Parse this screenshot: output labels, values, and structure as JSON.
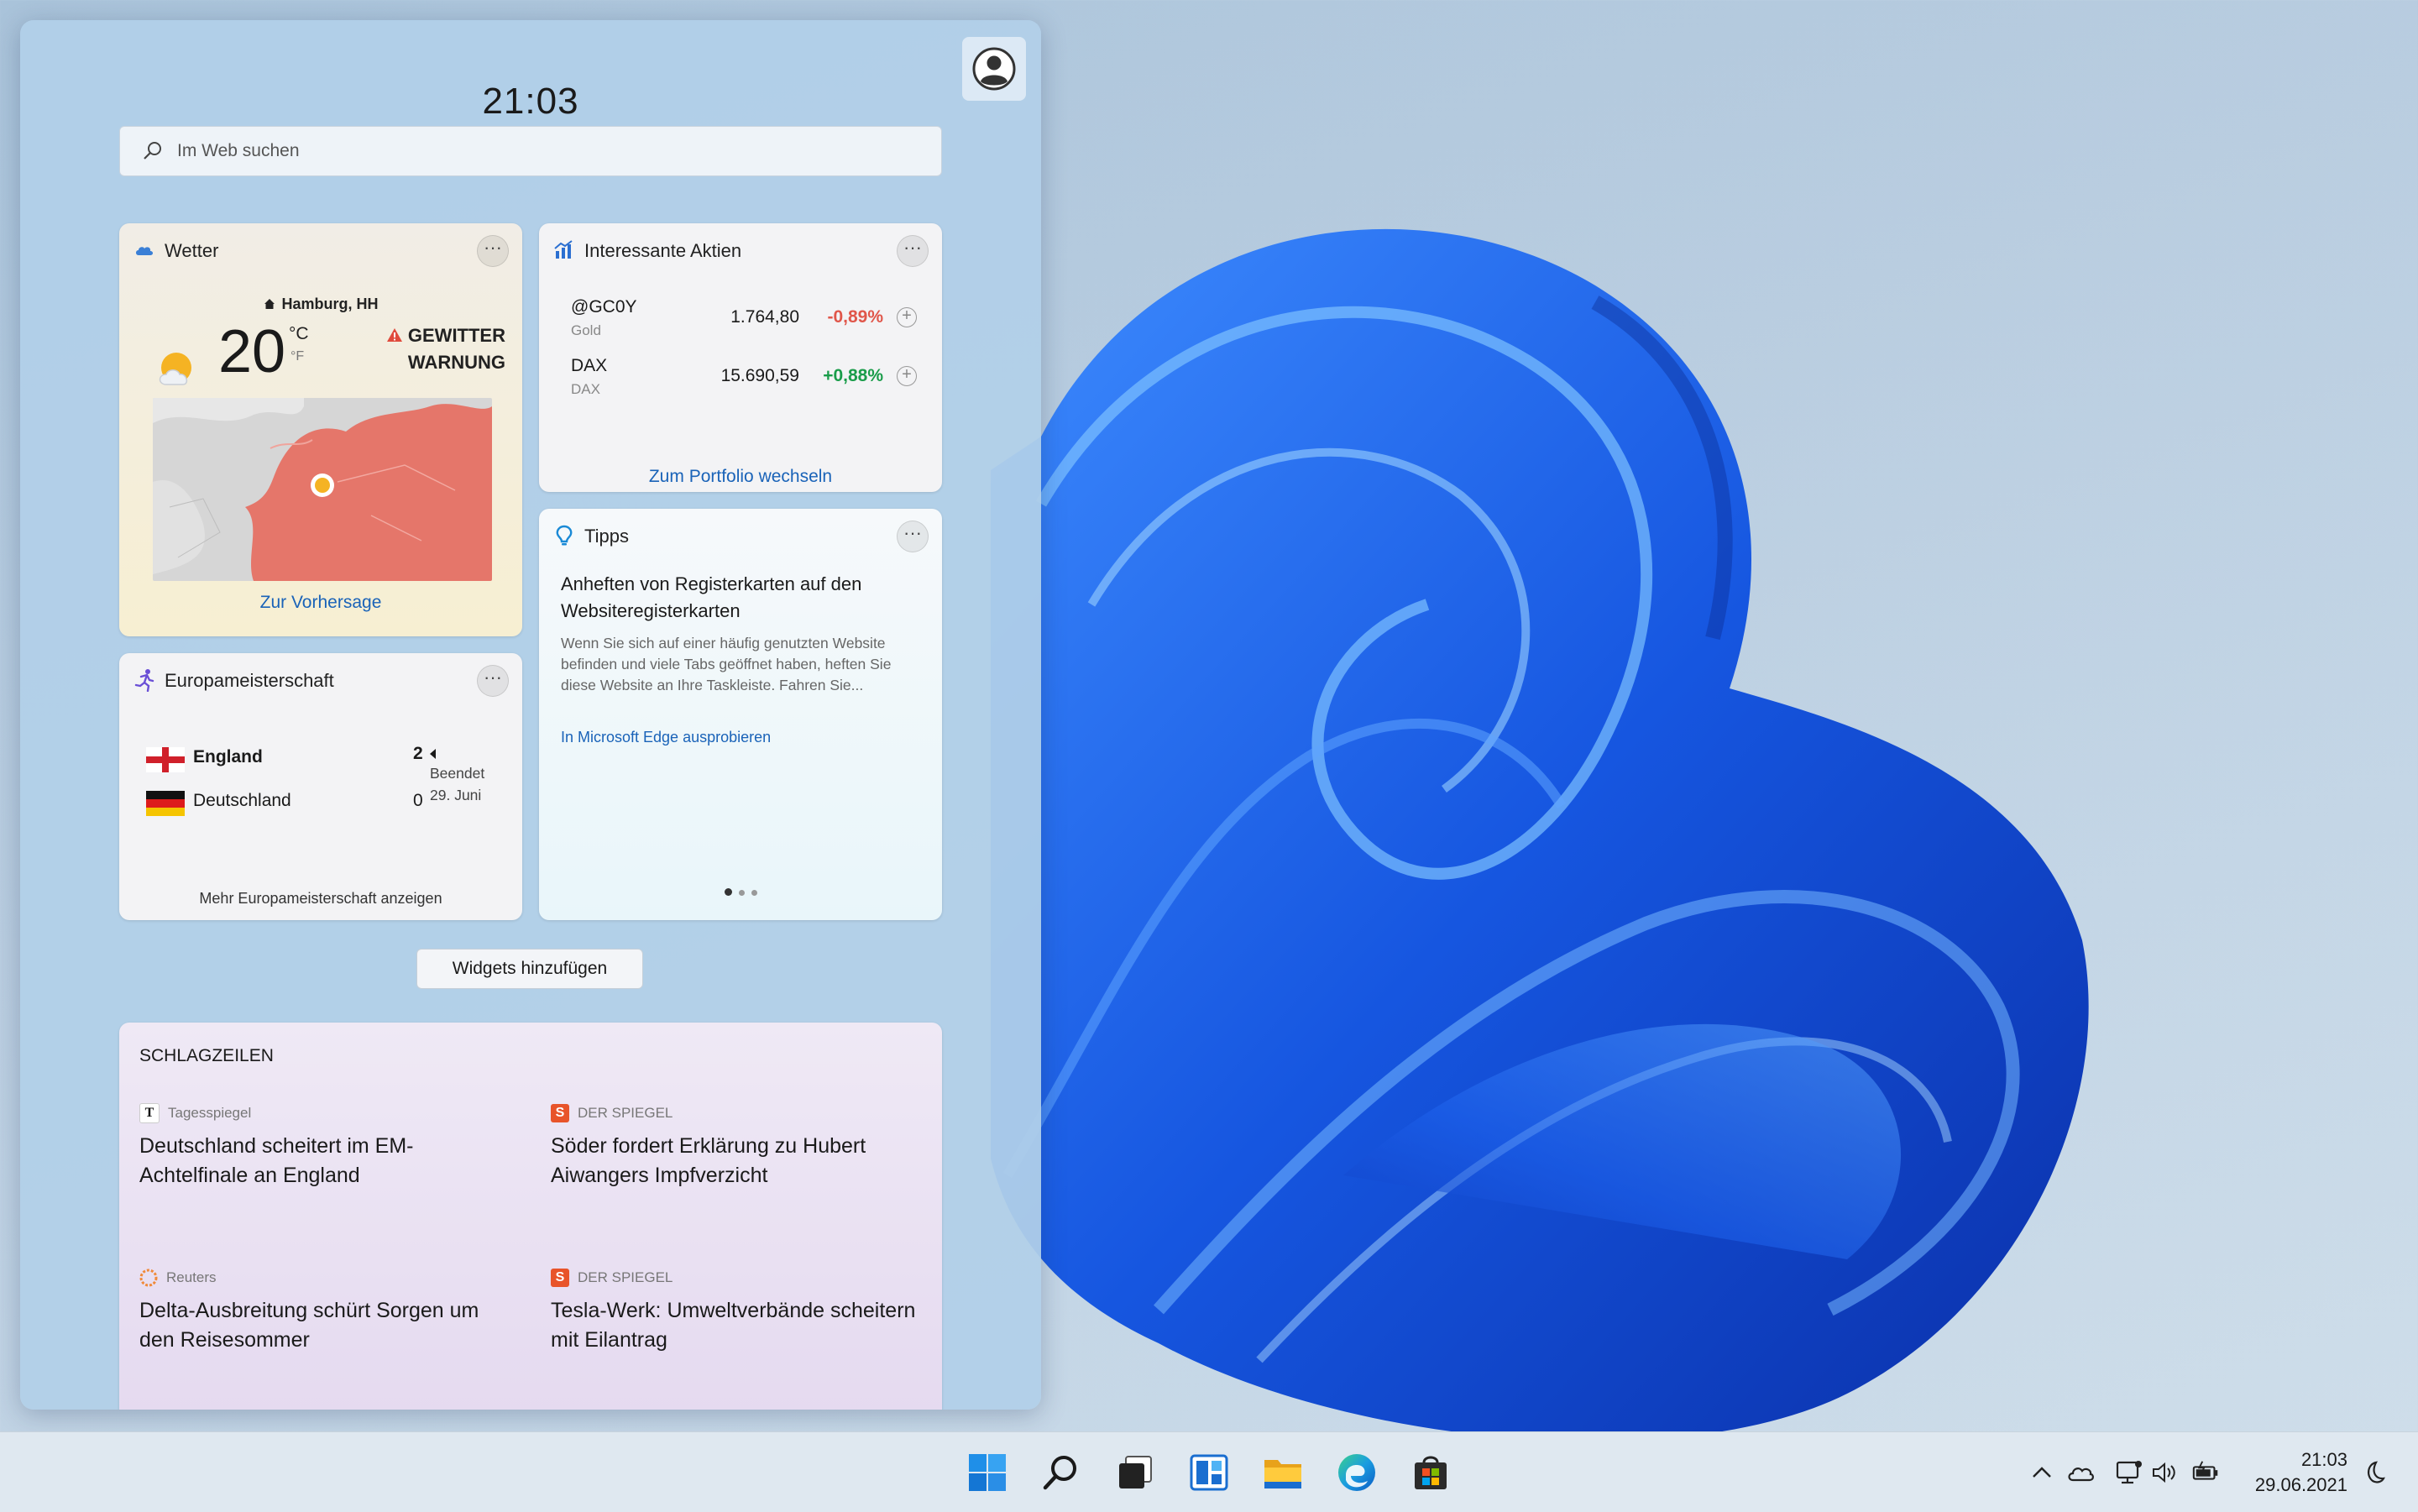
{
  "widgets": {
    "clock": "21:03",
    "search": {
      "placeholder": "Im Web suchen"
    },
    "weather": {
      "title": "Wetter",
      "location": "Hamburg, HH",
      "temperature": "20",
      "unit_c": "°C",
      "unit_f": "°F",
      "warning_line1": "GEWITTER",
      "warning_line2": "WARNUNG",
      "link": "Zur Vorhersage",
      "icon": "partly-sunny-icon"
    },
    "stocks": {
      "title": "Interessante Aktien",
      "items": [
        {
          "symbol": "@GC0Y",
          "name": "Gold",
          "value": "1.764,80",
          "change": "-0,89%",
          "color": "#e0564a"
        },
        {
          "symbol": "DAX",
          "name": "DAX",
          "value": "15.690,59",
          "change": "+0,88%",
          "color": "#1a9c4a"
        }
      ],
      "link": "Zum Portfolio wechseln"
    },
    "tips": {
      "title": "Tipps",
      "headline": "Anheften von Registerkarten auf den Websiteregisterkarten",
      "body": "Wenn Sie sich auf einer häufig genutzten Website befinden und viele Tabs geöffnet haben, heften Sie diese Website an Ihre Taskleiste. Fahren Sie...",
      "link": "In Microsoft Edge ausprobieren"
    },
    "euro": {
      "title": "Europameisterschaft",
      "team1": "England",
      "score1": "2",
      "team2": "Deutschland",
      "score2": "0",
      "status": "Beendet",
      "date": "29. Juni",
      "more": "Mehr Europameisterschaft anzeigen"
    },
    "add_widgets": "Widgets hinzufügen",
    "news": {
      "title": "SCHLAGZEILEN",
      "articles": [
        {
          "source": "Tagesspiegel",
          "logo": "T",
          "headline": "Deutschland scheitert im EM-Achtelfinale an England"
        },
        {
          "source": "DER SPIEGEL",
          "logo": "S",
          "headline": "Söder fordert Erklärung zu Hubert Aiwangers Impfverzicht"
        },
        {
          "source": "Reuters",
          "logo": "",
          "headline": "Delta-Ausbreitung schürt Sorgen um den Reisesommer"
        },
        {
          "source": "DER SPIEGEL",
          "logo": "S",
          "headline": "Tesla-Werk: Umweltverbände scheitern mit Eilantrag"
        }
      ]
    }
  },
  "taskbar": {
    "apps": [
      "start-icon",
      "search-icon",
      "task-view-icon",
      "widgets-icon",
      "file-explorer-icon",
      "edge-icon",
      "store-icon"
    ],
    "tray": [
      "chevron-up-icon",
      "onedrive-icon",
      "network-icon",
      "volume-icon",
      "battery-icon"
    ],
    "time": "21:03",
    "date": "29.06.2021"
  },
  "colors": {
    "accent": "#1a63b8",
    "wallpaper_bloom": "#1a5de0"
  }
}
